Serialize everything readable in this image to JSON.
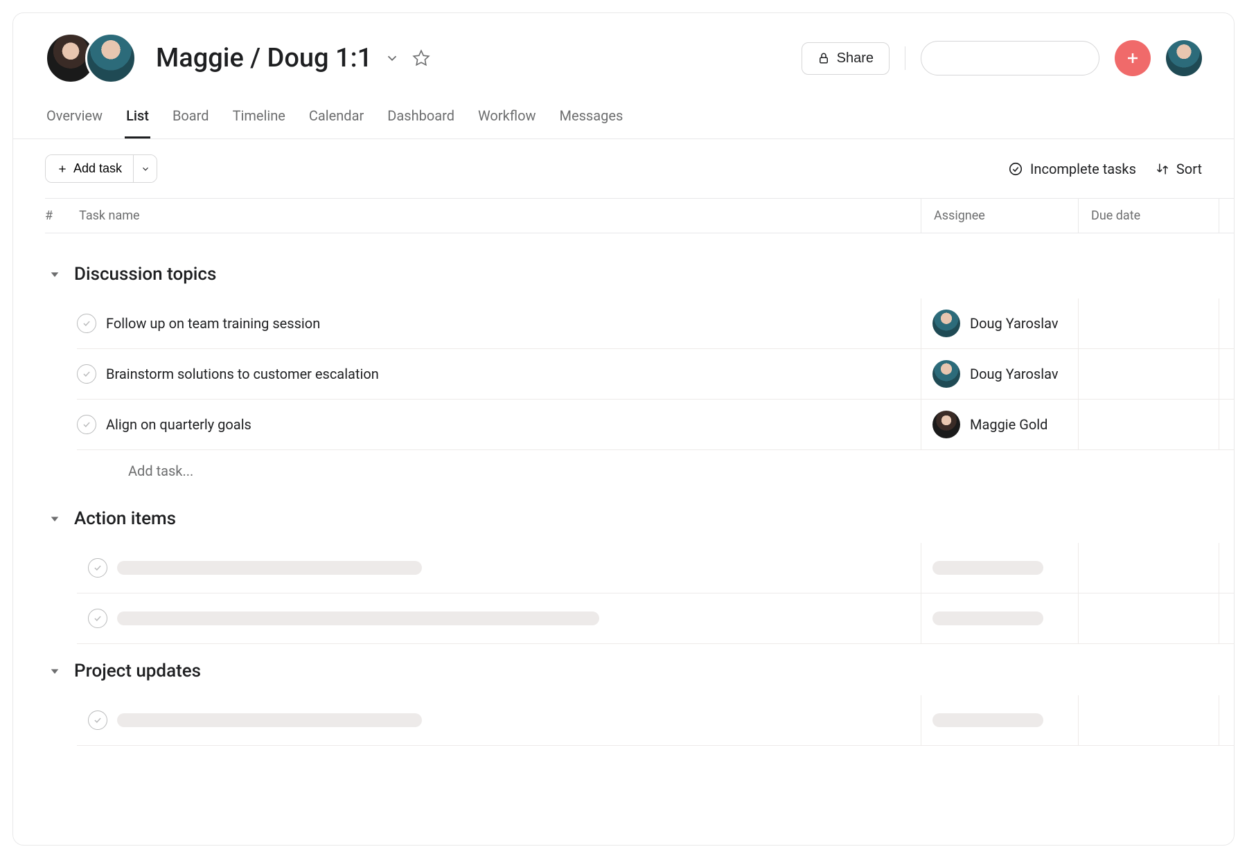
{
  "header": {
    "title": "Maggie / Doug 1:1",
    "share_label": "Share",
    "search_placeholder": ""
  },
  "tabs": [
    {
      "id": "overview",
      "label": "Overview",
      "active": false
    },
    {
      "id": "list",
      "label": "List",
      "active": true
    },
    {
      "id": "board",
      "label": "Board",
      "active": false
    },
    {
      "id": "timeline",
      "label": "Timeline",
      "active": false
    },
    {
      "id": "calendar",
      "label": "Calendar",
      "active": false
    },
    {
      "id": "dashboard",
      "label": "Dashboard",
      "active": false
    },
    {
      "id": "workflow",
      "label": "Workflow",
      "active": false
    },
    {
      "id": "messages",
      "label": "Messages",
      "active": false
    }
  ],
  "toolbar": {
    "add_task_label": "Add task",
    "filter_label": "Incomplete tasks",
    "sort_label": "Sort"
  },
  "columns": {
    "index": "#",
    "name": "Task name",
    "assignee": "Assignee",
    "due": "Due date"
  },
  "sections": [
    {
      "id": "discussion",
      "title": "Discussion topics",
      "add_task_placeholder": "Add task...",
      "tasks": [
        {
          "name": "Follow up on team training session",
          "assignee": "Doug Yaroslav",
          "avatar": "doug"
        },
        {
          "name": "Brainstorm solutions to customer escalation",
          "assignee": "Doug Yaroslav",
          "avatar": "doug"
        },
        {
          "name": "Align on quarterly goals",
          "assignee": "Maggie Gold",
          "avatar": "maggie"
        }
      ]
    },
    {
      "id": "action",
      "title": "Action items",
      "skeleton_rows": 2
    },
    {
      "id": "updates",
      "title": "Project updates",
      "skeleton_rows": 1
    }
  ],
  "colors": {
    "accent": "#f06a6a"
  }
}
